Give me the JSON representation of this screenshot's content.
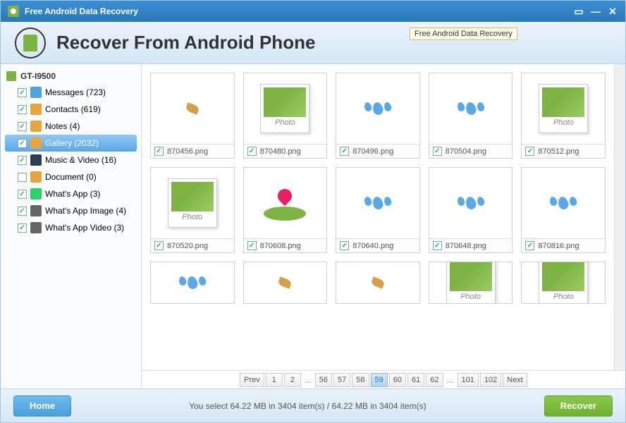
{
  "titlebar": {
    "title": "Free Android Data Recovery"
  },
  "header": {
    "title": "Recover From Android Phone",
    "tooltip": "Free Android Data Recovery"
  },
  "device": {
    "name": "GT-I9500"
  },
  "sidebar": {
    "items": [
      {
        "label": "Messages (723)",
        "checked": true,
        "icon": "ic-msg"
      },
      {
        "label": "Contacts (619)",
        "checked": true,
        "icon": "ic-contact"
      },
      {
        "label": "Notes (4)",
        "checked": true,
        "icon": "ic-notes"
      },
      {
        "label": "Gallery (2032)",
        "checked": true,
        "icon": "ic-gallery",
        "selected": true
      },
      {
        "label": "Music & Video (16)",
        "checked": true,
        "icon": "ic-music"
      },
      {
        "label": "Document (0)",
        "checked": false,
        "icon": "ic-doc"
      },
      {
        "label": "What's App (3)",
        "checked": true,
        "icon": "ic-wa"
      },
      {
        "label": "What's App Image (4)",
        "checked": true,
        "icon": "ic-waimg"
      },
      {
        "label": "What's App Video (3)",
        "checked": true,
        "icon": "ic-wavid"
      }
    ]
  },
  "thumbnails": [
    {
      "name": "870456.png",
      "checked": true,
      "kind": "leaf"
    },
    {
      "name": "870480.png",
      "checked": true,
      "kind": "photo"
    },
    {
      "name": "870496.png",
      "checked": true,
      "kind": "drops"
    },
    {
      "name": "870504.png",
      "checked": true,
      "kind": "drops"
    },
    {
      "name": "870512.png",
      "checked": true,
      "kind": "photo"
    },
    {
      "name": "870520.png",
      "checked": true,
      "kind": "photo"
    },
    {
      "name": "870608.png",
      "checked": true,
      "kind": "lotus"
    },
    {
      "name": "870640.png",
      "checked": true,
      "kind": "drops"
    },
    {
      "name": "870648.png",
      "checked": true,
      "kind": "drops"
    },
    {
      "name": "870816.png",
      "checked": true,
      "kind": "drops"
    },
    {
      "name": "",
      "checked": false,
      "kind": "drops",
      "partial": true
    },
    {
      "name": "",
      "checked": false,
      "kind": "leaf",
      "partial": true
    },
    {
      "name": "",
      "checked": false,
      "kind": "leaf",
      "partial": true
    },
    {
      "name": "",
      "checked": false,
      "kind": "photo",
      "partial": true
    },
    {
      "name": "",
      "checked": false,
      "kind": "photo",
      "partial": true
    }
  ],
  "paginator": {
    "prev": "Prev",
    "next": "Next",
    "pages": [
      "1",
      "2",
      "...",
      "56",
      "57",
      "58",
      "59",
      "60",
      "61",
      "62",
      "...",
      "101",
      "102"
    ],
    "active": "59"
  },
  "footer": {
    "home": "Home",
    "recover": "Recover",
    "status": "You select 64.22 MB in 3404 item(s) / 64.22 MB in 3404 item(s)"
  }
}
